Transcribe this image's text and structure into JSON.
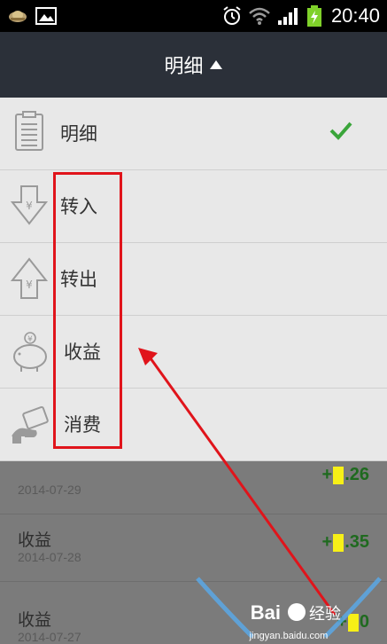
{
  "status_bar": {
    "time": "20:40",
    "icons": [
      "app-badge-icon",
      "gallery-icon",
      "alarm-icon",
      "wifi-icon",
      "signal-icon",
      "battery-charging-icon"
    ]
  },
  "header": {
    "title": "明细",
    "caret_icon": "caret-up-icon"
  },
  "menu": {
    "items": [
      {
        "label": "明细",
        "icon": "list-icon",
        "selected": true
      },
      {
        "label": "转入",
        "icon": "transfer-in-icon",
        "selected": false
      },
      {
        "label": "转出",
        "icon": "transfer-out-icon",
        "selected": false
      },
      {
        "label": "收益",
        "icon": "piggy-bank-icon",
        "selected": false
      },
      {
        "label": "消费",
        "icon": "consumption-icon",
        "selected": false
      }
    ],
    "check_icon": "check-icon",
    "check_color": "#3aa53a"
  },
  "background_list": {
    "rows": [
      {
        "title": "",
        "date": "2014-07-29",
        "amount_prefix": "+",
        "amount_suffix": ".26"
      },
      {
        "title": "收益",
        "date": "2014-07-28",
        "amount_prefix": "+",
        "amount_suffix": ".35"
      },
      {
        "title": "收益",
        "date": "2014-07-27",
        "amount_prefix": "+",
        "amount_suffix": "0"
      }
    ]
  },
  "annotation": {
    "color": "#e0141b"
  },
  "watermark": {
    "brand": "Bai",
    "brand_suffix": "经验",
    "url": "jingyan.baidu.com"
  },
  "colors": {
    "header_bg": "#2b3039",
    "menu_bg": "#e8e8e8",
    "overlay_bg": "#7b7b7b",
    "amount_green": "#1f6a1f",
    "highlight_yellow": "#f7f017"
  }
}
